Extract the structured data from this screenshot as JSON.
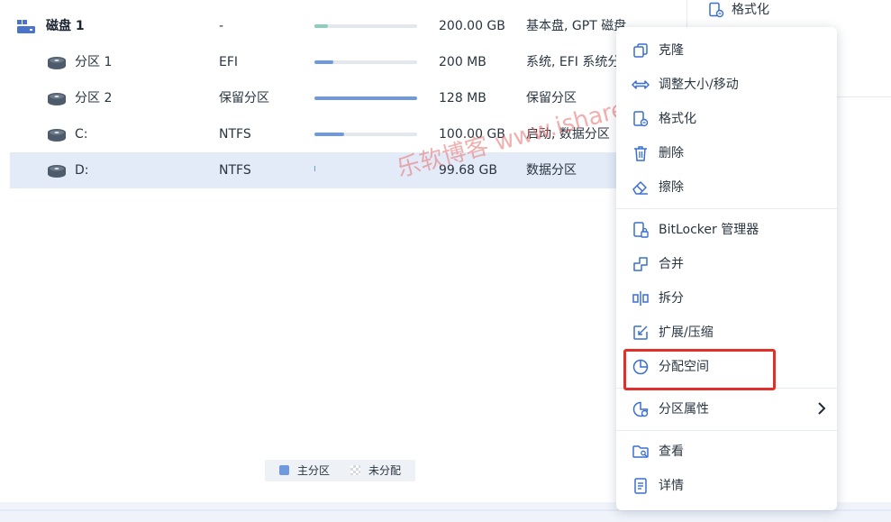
{
  "top_panel": {
    "format_label": "格式化"
  },
  "rows": [
    {
      "name": "磁盘 1",
      "fs": "-",
      "usage": 0.13,
      "size": "200.00 GB",
      "info": "基本盘, GPT 磁盘"
    },
    {
      "name": "分区 1",
      "fs": "EFI",
      "usage": 0.18,
      "size": "200 MB",
      "info": "系统, EFI 系统分区"
    },
    {
      "name": "分区 2",
      "fs": "保留分区",
      "usage": 1.0,
      "size": "128 MB",
      "info": "保留分区"
    },
    {
      "name": "C:",
      "fs": "NTFS",
      "usage": 0.29,
      "size": "100.00 GB",
      "info": "启动, 数据分区"
    },
    {
      "name": "D:",
      "fs": "NTFS",
      "usage": 0.01,
      "size": "99.68 GB",
      "info": "数据分区"
    }
  ],
  "menu": {
    "items": [
      {
        "label": "克隆",
        "icon": "clone-icon"
      },
      {
        "label": "调整大小/移动",
        "icon": "resize-move-icon"
      },
      {
        "label": "格式化",
        "icon": "format-icon"
      },
      {
        "label": "删除",
        "icon": "trash-icon"
      },
      {
        "label": "擦除",
        "icon": "eraser-icon"
      },
      {
        "label": "BitLocker 管理器",
        "icon": "bitlocker-icon"
      },
      {
        "label": "合并",
        "icon": "merge-icon"
      },
      {
        "label": "拆分",
        "icon": "split-icon"
      },
      {
        "label": "扩展/压缩",
        "icon": "extend-shrink-icon"
      },
      {
        "label": "分配空间",
        "icon": "allocate-space-icon"
      },
      {
        "label": "分区属性",
        "icon": "partition-properties-icon"
      },
      {
        "label": "查看",
        "icon": "explore-icon"
      },
      {
        "label": "详情",
        "icon": "details-icon"
      }
    ]
  },
  "legend": {
    "primary": "主分区",
    "unallocated": "未分配"
  },
  "watermark": "乐软博客 www.isharepc.com",
  "colors": {
    "accent": "#6f9ae0",
    "selected_row": "#e3ebf8",
    "highlight": "#e1302a",
    "disk_bar": "#8ccdbb"
  }
}
